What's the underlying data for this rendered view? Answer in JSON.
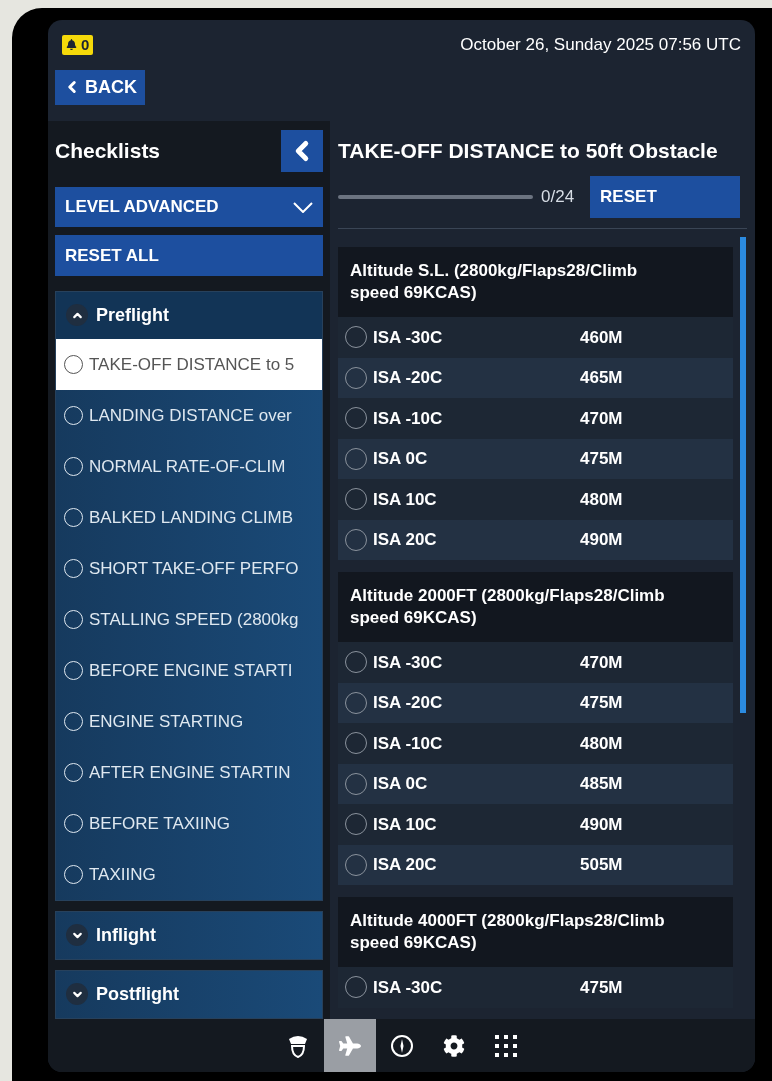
{
  "notifications": {
    "count": "0"
  },
  "datetime": "October 26, Sunday 2025 07:56 UTC",
  "back_button": {
    "label": "BACK"
  },
  "sidebar": {
    "title": "Checklists",
    "level_dropdown": {
      "value": "LEVEL ADVANCED"
    },
    "reset_all": "RESET ALL",
    "groups": [
      {
        "title": "Preflight",
        "expanded": true,
        "items": [
          {
            "label": "TAKE-OFF DISTANCE to 5",
            "selected": true,
            "checked": false
          },
          {
            "label": "LANDING DISTANCE over",
            "selected": false,
            "checked": false
          },
          {
            "label": "NORMAL RATE-OF-CLIM",
            "selected": false,
            "checked": false
          },
          {
            "label": "BALKED LANDING CLIMB",
            "selected": false,
            "checked": false
          },
          {
            "label": "SHORT TAKE-OFF PERFO",
            "selected": false,
            "checked": false
          },
          {
            "label": "STALLING SPEED (2800kg",
            "selected": false,
            "checked": false
          },
          {
            "label": "BEFORE ENGINE STARTI",
            "selected": false,
            "checked": false
          },
          {
            "label": "ENGINE STARTING",
            "selected": false,
            "checked": false
          },
          {
            "label": "AFTER ENGINE STARTIN",
            "selected": false,
            "checked": false
          },
          {
            "label": "BEFORE TAXIING",
            "selected": false,
            "checked": false
          },
          {
            "label": "TAXIING",
            "selected": false,
            "checked": false
          }
        ]
      },
      {
        "title": "Inflight",
        "expanded": false
      },
      {
        "title": "Postflight",
        "expanded": false
      }
    ]
  },
  "checklist": {
    "title": "TAKE-OFF DISTANCE to 50ft Obstacle",
    "progress": {
      "reading": "0/24"
    },
    "reset": "RESET",
    "sections": [
      {
        "title": "Altitude S.L. (2800kg/Flaps28/Climb speed 69KCAS)",
        "rows": [
          {
            "condition": "ISA -30C",
            "value": "460M",
            "checked": false
          },
          {
            "condition": "ISA -20C",
            "value": "465M",
            "checked": false
          },
          {
            "condition": "ISA -10C",
            "value": "470M",
            "checked": false
          },
          {
            "condition": "ISA 0C",
            "value": "475M",
            "checked": false
          },
          {
            "condition": "ISA 10C",
            "value": "480M",
            "checked": false
          },
          {
            "condition": "ISA 20C",
            "value": "490M",
            "checked": false
          }
        ]
      },
      {
        "title": "Altitude 2000FT (2800kg/Flaps28/Climb speed 69KCAS)",
        "rows": [
          {
            "condition": "ISA -30C",
            "value": "470M",
            "checked": false
          },
          {
            "condition": "ISA -20C",
            "value": "475M",
            "checked": false
          },
          {
            "condition": "ISA -10C",
            "value": "480M",
            "checked": false
          },
          {
            "condition": "ISA 0C",
            "value": "485M",
            "checked": false
          },
          {
            "condition": "ISA 10C",
            "value": "490M",
            "checked": false
          },
          {
            "condition": "ISA 20C",
            "value": "505M",
            "checked": false
          }
        ]
      },
      {
        "title": "Altitude 4000FT (2800kg/Flaps28/Climb speed 69KCAS)",
        "rows": [
          {
            "condition": "ISA -30C",
            "value": "475M",
            "checked": false
          }
        ]
      }
    ]
  },
  "nav": [
    {
      "kind": "pilot",
      "selected": false
    },
    {
      "kind": "plane",
      "selected": true
    },
    {
      "kind": "compass",
      "selected": false
    },
    {
      "kind": "settings",
      "selected": false
    },
    {
      "kind": "apps",
      "selected": false
    }
  ]
}
